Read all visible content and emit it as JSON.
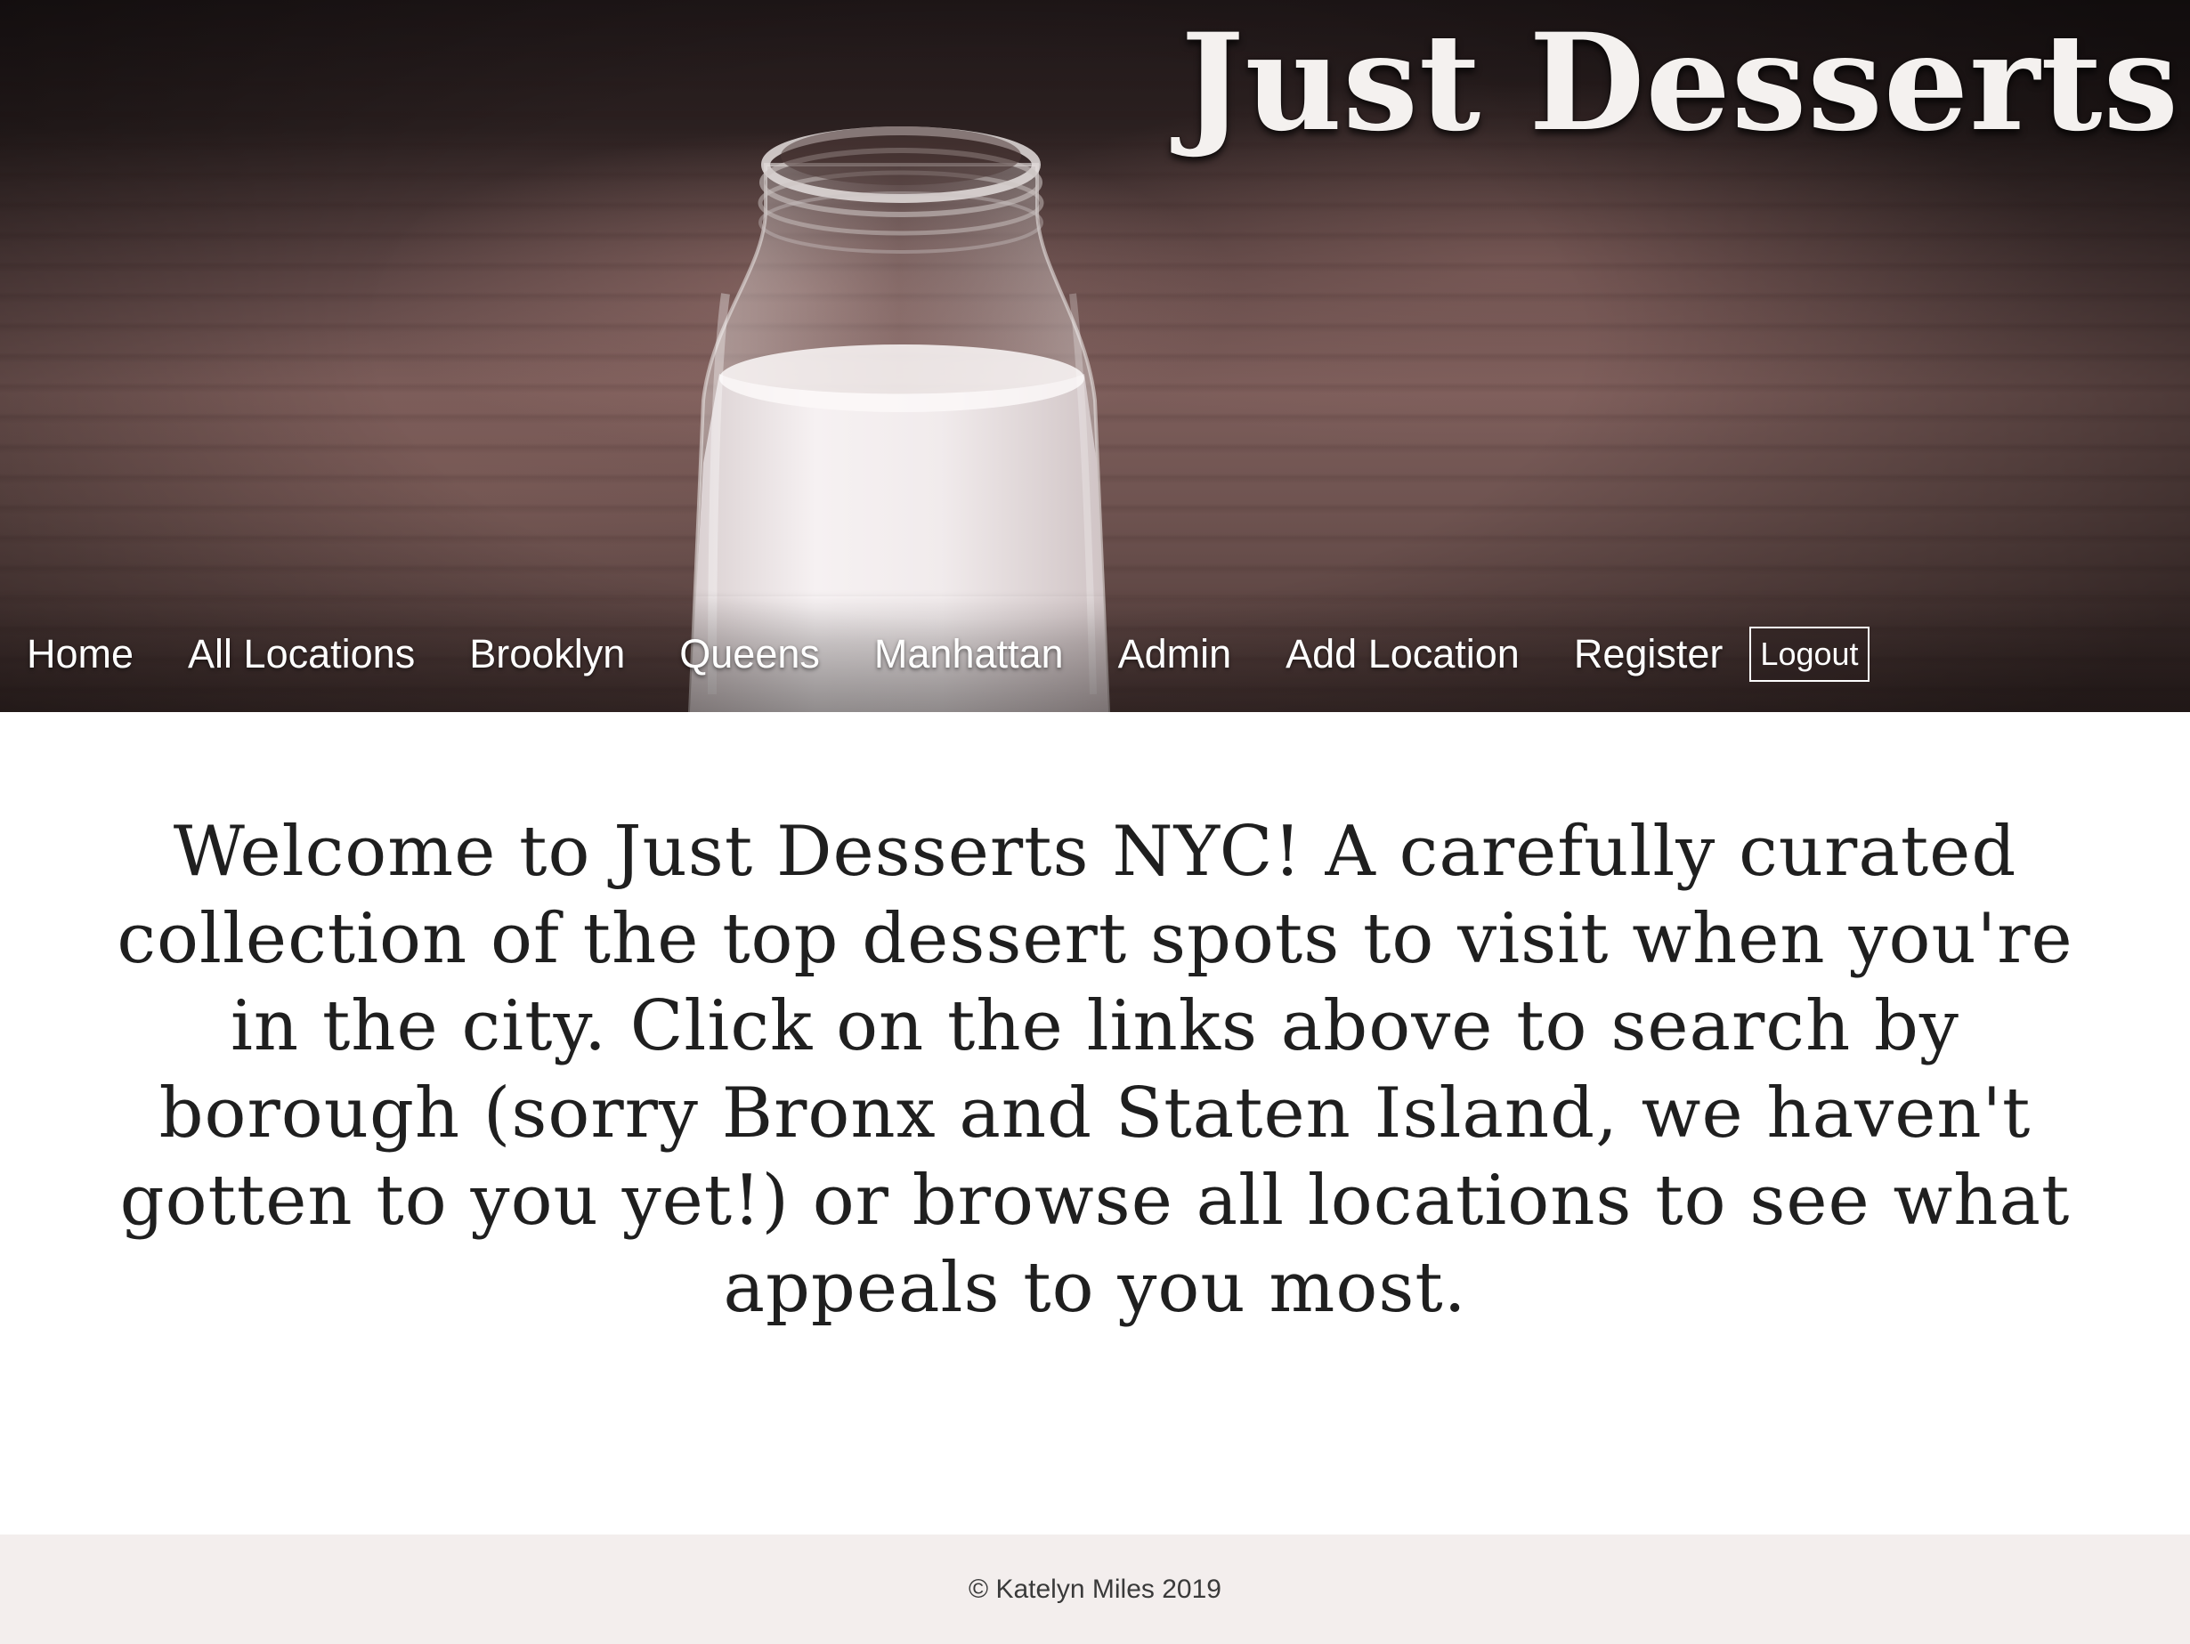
{
  "header": {
    "title": "Just Desserts"
  },
  "nav": {
    "items": [
      {
        "label": "Home"
      },
      {
        "label": "All Locations"
      },
      {
        "label": "Brooklyn"
      },
      {
        "label": "Queens"
      },
      {
        "label": "Manhattan"
      },
      {
        "label": "Admin"
      },
      {
        "label": "Add Location"
      },
      {
        "label": "Register"
      }
    ],
    "logout_label": "Logout"
  },
  "main": {
    "welcome": "Welcome to Just Desserts NYC! A carefully curated collection of the top dessert spots to visit when you're in the city. Click on the links above to search by borough (sorry Bronx and Staten Island, we haven't gotten to you yet!) or browse all locations to see what appeals to you most."
  },
  "footer": {
    "copyright": "© Katelyn Miles 2019"
  },
  "colors": {
    "footer_bg": "#f3eeed",
    "title": "#f4f1ef",
    "body_text": "#1f1f1f"
  },
  "images": {
    "hero": "milk-bottle-photo"
  }
}
